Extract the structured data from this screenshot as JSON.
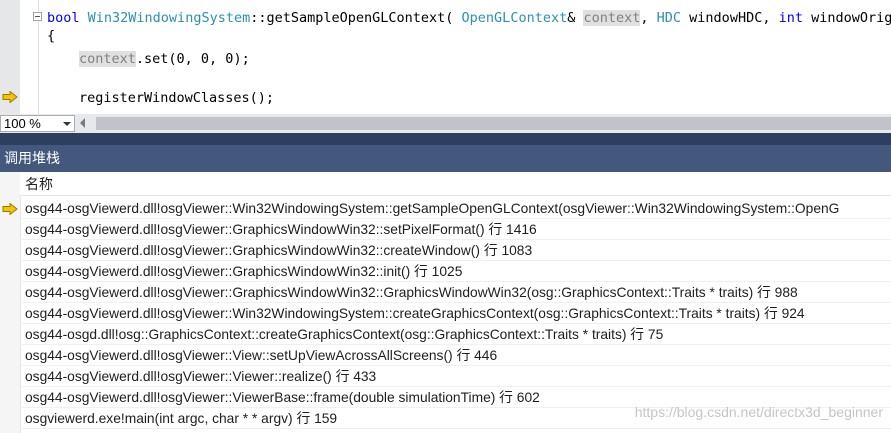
{
  "editor": {
    "line1": {
      "kw_bool": "bool",
      "class_name": "Win32WindowingSystem",
      "scope": "::getSampleOpenGLContext( ",
      "param_type": "OpenGLContext",
      "amp": "& ",
      "param_name": "context",
      "comma1": ", ",
      "hdc_type": "HDC",
      "hdc_name": " windowHDC, ",
      "kw_int": "int",
      "rest": " windowOrigin"
    },
    "line2": {
      "brace": "{"
    },
    "line3": {
      "ref": "context",
      "rest": ".set(0, 0, 0);"
    },
    "line4": {
      "text": "registerWindowClasses();"
    }
  },
  "zoom": {
    "value": "100 %"
  },
  "call_stack": {
    "title": "调用堆栈",
    "column_name": "名称",
    "current_frame_icon": "yellow-arrow-icon",
    "frames": [
      "osg44-osgViewerd.dll!osgViewer::Win32WindowingSystem::getSampleOpenGLContext(osgViewer::Win32WindowingSystem::OpenG",
      "osg44-osgViewerd.dll!osgViewer::GraphicsWindowWin32::setPixelFormat() 行 1416",
      "osg44-osgViewerd.dll!osgViewer::GraphicsWindowWin32::createWindow() 行 1083",
      "osg44-osgViewerd.dll!osgViewer::GraphicsWindowWin32::init() 行 1025",
      "osg44-osgViewerd.dll!osgViewer::GraphicsWindowWin32::GraphicsWindowWin32(osg::GraphicsContext::Traits * traits) 行 988",
      "osg44-osgViewerd.dll!osgViewer::Win32WindowingSystem::createGraphicsContext(osg::GraphicsContext::Traits * traits) 行 924",
      "osg44-osgd.dll!osg::GraphicsContext::createGraphicsContext(osg::GraphicsContext::Traits * traits) 行 75",
      "osg44-osgViewerd.dll!osgViewer::View::setUpViewAcrossAllScreens() 行 446",
      "osg44-osgViewerd.dll!osgViewer::Viewer::realize() 行 433",
      "osg44-osgViewerd.dll!osgViewer::ViewerBase::frame(double simulationTime) 行 602",
      "osgviewerd.exe!main(int argc, char * * argv) 行 159"
    ]
  },
  "watermark": "https://blog.csdn.net/directx3d_beginner",
  "colors": {
    "keyword": "#0000ff",
    "type": "#2b91af",
    "panel_header": "#44577d",
    "arrow": "#f5c400"
  }
}
